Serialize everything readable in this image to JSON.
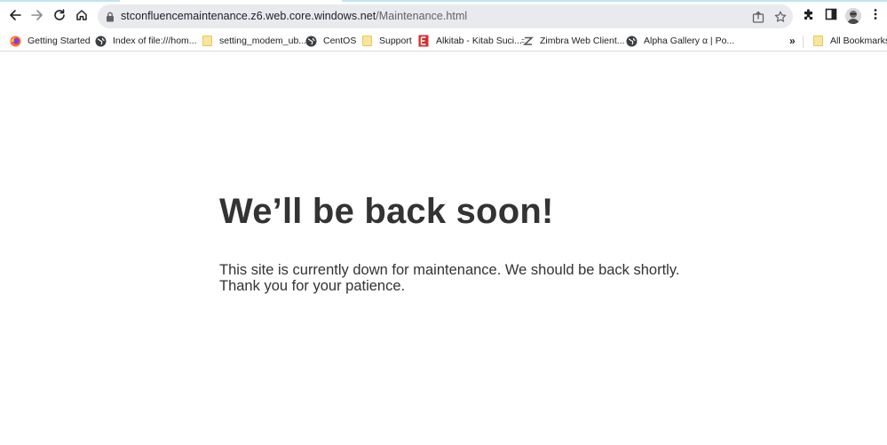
{
  "browser": {
    "address_bar": {
      "host": "stconfluencemaintenance.z6.web.core.windows.net",
      "path": "/Maintenance.html"
    },
    "icons": {
      "back": "arrow-left-icon",
      "forward": "arrow-right-icon",
      "reload": "reload-icon",
      "home": "home-icon",
      "lock": "lock-icon",
      "share": "share-icon",
      "bookmark_star": "star-icon",
      "extensions": "puzzle-icon",
      "side_panel": "side-panel-icon",
      "menu": "kebab-menu-icon"
    }
  },
  "bookmarks_bar": {
    "items": [
      {
        "label": "Getting Started",
        "icon": "firefox-icon"
      },
      {
        "label": "Index of file:///hom...",
        "icon": "globe-icon"
      },
      {
        "label": "setting_modem_ub...",
        "icon": "folder-icon"
      },
      {
        "label": "CentOS",
        "icon": "globe-icon"
      },
      {
        "label": "Support",
        "icon": "folder-icon"
      },
      {
        "label": "Alkitab - Kitab Suci...",
        "icon": "alkitab-icon"
      },
      {
        "label": "Zimbra Web Client...",
        "icon": "zimbra-icon"
      },
      {
        "label": "Alpha Gallery α | Po...",
        "icon": "globe-icon"
      }
    ],
    "overflow_label": "»",
    "all_bookmarks_label": "All Bookmarks"
  },
  "page": {
    "heading": "We’ll be back soon!",
    "message_line1": "This site is currently down for maintenance. We should be back shortly.",
    "message_line2": "Thank you for your patience."
  },
  "colors": {
    "text": "#333333",
    "omnibox_bg": "#e8eaed",
    "folder": "#fbe49b",
    "alkitab_red": "#d32f2f"
  }
}
